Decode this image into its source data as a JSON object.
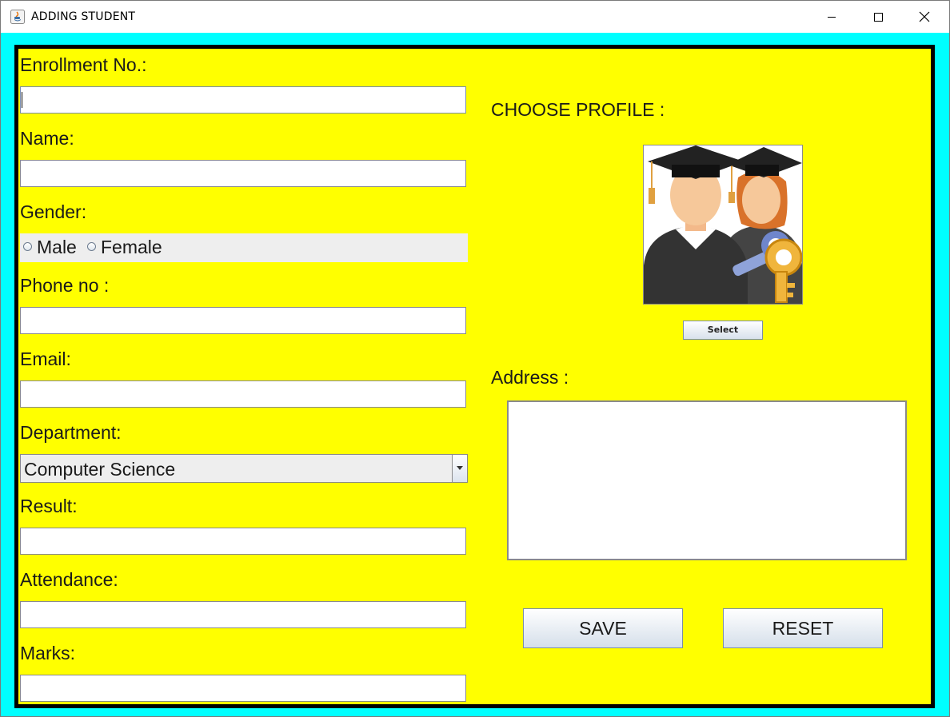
{
  "window": {
    "title": "ADDING STUDENT",
    "icons": {
      "app": "java-icon",
      "minimize": "minimize-icon",
      "maximize": "maximize-icon",
      "close": "close-icon"
    }
  },
  "form": {
    "enrollment": {
      "label": "Enrollment No.:",
      "value": ""
    },
    "name": {
      "label": "Name:",
      "value": ""
    },
    "gender": {
      "label": "Gender:",
      "options": [
        "Male",
        "Female"
      ],
      "selected": ""
    },
    "phone": {
      "label": "Phone no :",
      "value": ""
    },
    "email": {
      "label": "Email:",
      "value": ""
    },
    "department": {
      "label": "Department:",
      "selected": "Computer Science"
    },
    "result": {
      "label": "Result:",
      "value": ""
    },
    "attendance": {
      "label": "Attendance:",
      "value": ""
    },
    "marks": {
      "label": "Marks:",
      "value": ""
    }
  },
  "profile": {
    "label": "CHOOSE PROFILE :",
    "image": "graduate-students-key-icon",
    "select_button": "Select"
  },
  "address": {
    "label": "Address :",
    "value": ""
  },
  "actions": {
    "save": "SAVE",
    "reset": "RESET"
  },
  "colors": {
    "frame": "#00ffff",
    "panel": "#ffff00",
    "border": "#000000"
  }
}
